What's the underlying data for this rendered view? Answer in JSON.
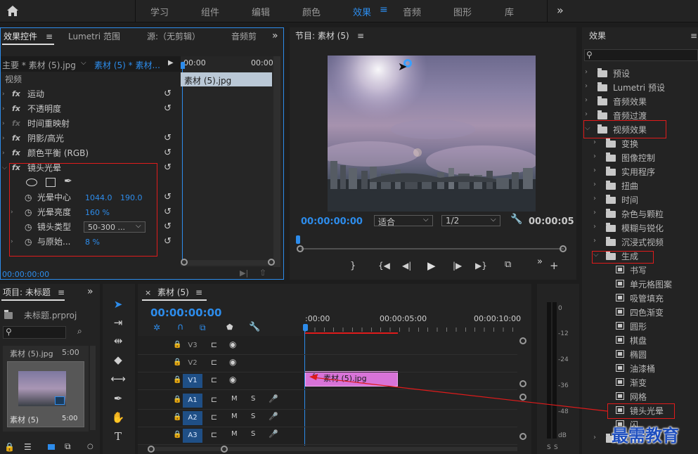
{
  "topbar": {
    "home_icon": "home-icon",
    "workspaces": [
      "学习",
      "组件",
      "编辑",
      "颜色",
      "效果",
      "音频",
      "图形",
      "库"
    ],
    "active": "效果",
    "more": "»"
  },
  "effect_controls": {
    "tabs": [
      "效果控件",
      "Lumetri 范围",
      "源:（无剪辑）",
      "音频剪"
    ],
    "master_clip": "主要 * 素材 (5).jpg",
    "sequence_clip": "素材 (5) * 素材...",
    "timeline_start": "00:00",
    "timeline_end": "00:00",
    "clip_name": "素材 (5).jpg",
    "section": "视频",
    "effects": [
      "运动",
      "不透明度",
      "时间重映射",
      "阴影/高光",
      "颜色平衡 (RGB)",
      "镜头光晕"
    ],
    "lens_flare": {
      "center_label": "光晕中心",
      "center_x": "1044.0",
      "center_y": "190.0",
      "brightness_label": "光晕亮度",
      "brightness": "160 %",
      "type_label": "镜头类型",
      "type_value": "50-300 ...",
      "blend_label": "与原始...",
      "blend": "8 %"
    },
    "timecode": "00:00:00:00"
  },
  "program": {
    "title": "节目: 素材 (5)",
    "timecode": "00:00:00:00",
    "fit": "适合",
    "resolution": "1/2",
    "duration": "00:00:05"
  },
  "project": {
    "title": "项目: 未标题",
    "file": "未标题.prproj",
    "item_name": "素材 (5).jpg",
    "item_duration": "5:00",
    "thumb_name": "素材 (5)",
    "thumb_duration": "5:00"
  },
  "timeline": {
    "title": "素材 (5)",
    "timecode": "00:00:00:00",
    "ruler": [
      ":00:00",
      "00:00:05:00",
      "00:00:10:00"
    ],
    "video_tracks": [
      "V3",
      "V2",
      "V1"
    ],
    "audio_tracks": [
      "A1",
      "A2",
      "A3"
    ],
    "mute": "M",
    "solo": "S",
    "clip_name": "素材 (5).jpg",
    "clip_fx": "fx"
  },
  "meter": {
    "ticks": [
      "0",
      "-12",
      "-24",
      "-36",
      "-48",
      "dB"
    ]
  },
  "effects_panel": {
    "title": "效果",
    "items": [
      {
        "label": "预设",
        "level": 0
      },
      {
        "label": "Lumetri 预设",
        "level": 0
      },
      {
        "label": "音频效果",
        "level": 0
      },
      {
        "label": "音频过渡",
        "level": 0
      },
      {
        "label": "视频效果",
        "level": 0,
        "open": true
      },
      {
        "label": "变换",
        "level": 1
      },
      {
        "label": "图像控制",
        "level": 1
      },
      {
        "label": "实用程序",
        "level": 1
      },
      {
        "label": "扭曲",
        "level": 1
      },
      {
        "label": "时间",
        "level": 1
      },
      {
        "label": "杂色与颗粒",
        "level": 1
      },
      {
        "label": "模糊与锐化",
        "level": 1
      },
      {
        "label": "沉浸式视频",
        "level": 1
      },
      {
        "label": "生成",
        "level": 1,
        "open": true
      },
      {
        "label": "书写",
        "level": 2
      },
      {
        "label": "单元格图案",
        "level": 2
      },
      {
        "label": "吸管填充",
        "level": 2
      },
      {
        "label": "四色渐变",
        "level": 2
      },
      {
        "label": "圆形",
        "level": 2
      },
      {
        "label": "棋盘",
        "level": 2
      },
      {
        "label": "椭圆",
        "level": 2
      },
      {
        "label": "油漆桶",
        "level": 2
      },
      {
        "label": "渐变",
        "level": 2
      },
      {
        "label": "网格",
        "level": 2
      },
      {
        "label": "镜头光晕",
        "level": 2
      },
      {
        "label": "闪",
        "level": 2
      },
      {
        "label": "调整",
        "level": 1
      }
    ]
  },
  "watermark": "最需教育",
  "colors": {
    "accent": "#2d8ceb",
    "highlight": "#e01b1b",
    "clip": "#d873d8"
  }
}
